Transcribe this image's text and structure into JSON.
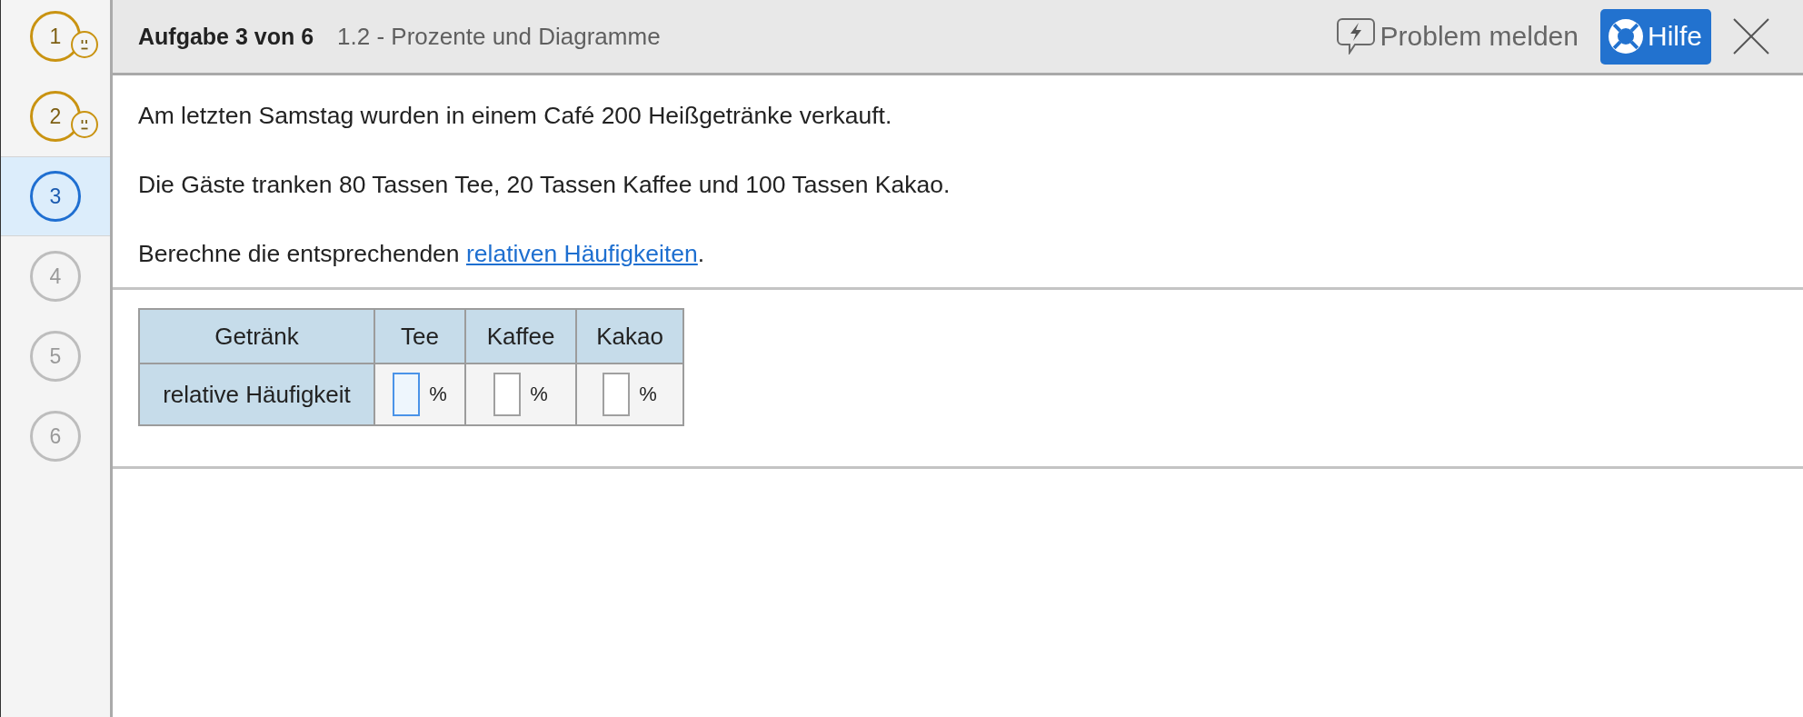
{
  "sidebar": {
    "tasks": [
      {
        "number": "1",
        "attempted": true,
        "selected": false
      },
      {
        "number": "2",
        "attempted": true,
        "selected": false
      },
      {
        "number": "3",
        "attempted": false,
        "selected": true
      },
      {
        "number": "4",
        "attempted": false,
        "selected": false
      },
      {
        "number": "5",
        "attempted": false,
        "selected": false
      },
      {
        "number": "6",
        "attempted": false,
        "selected": false
      }
    ]
  },
  "header": {
    "task_counter": "Aufgabe 3 von 6",
    "topic": "1.2 - Prozente und Diagramme",
    "report_button": "Problem melden",
    "help_button": "Hilfe"
  },
  "task_text": {
    "paragraphs": [
      {
        "text": "Am letzten Samstag wurden in einem Café 200 Heißgetränke verkauft."
      },
      {
        "text": "Die Gäste tranken 80 Tassen Tee, 20 Tassen Kaffee und 100 Tassen Kakao."
      },
      {
        "text": "Berechne die entsprechenden ",
        "link": "relativen Häufigkeiten",
        "after": "."
      }
    ]
  },
  "table": {
    "columns": [
      "Getränk",
      "Tee",
      "Kaffee",
      "Kakao"
    ],
    "rows": [
      {
        "cells": [
          {
            "kind": "label",
            "text": "relative Häufigkeit"
          },
          {
            "kind": "input",
            "unit": "%",
            "focused": true
          },
          {
            "kind": "input",
            "unit": "%",
            "focused": false
          },
          {
            "kind": "input",
            "unit": "%",
            "focused": false
          }
        ]
      }
    ]
  }
}
